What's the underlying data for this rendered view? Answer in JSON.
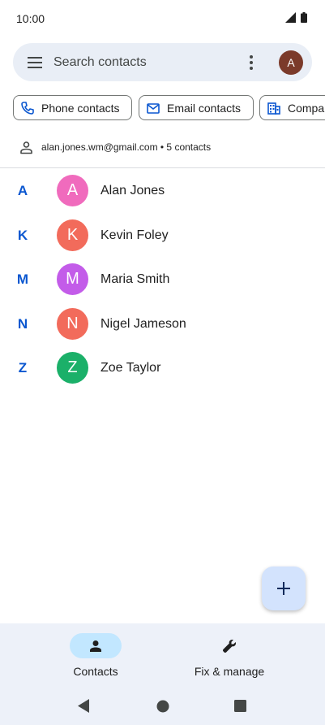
{
  "status_bar": {
    "time": "10:00"
  },
  "search": {
    "placeholder": "Search contacts",
    "account_avatar_letter": "A",
    "account_avatar_color": "#7b3a2a"
  },
  "chips": [
    {
      "label": "Phone contacts",
      "icon": "phone-icon"
    },
    {
      "label": "Email contacts",
      "icon": "email-icon"
    },
    {
      "label": "Compar",
      "icon": "building-icon"
    }
  ],
  "account": {
    "text": "alan.jones.wm@gmail.com • 5 contacts",
    "icon": "person-outline-icon"
  },
  "contacts": [
    {
      "section": "A",
      "initial": "A",
      "name": "Alan Jones",
      "color": "#f06bbd"
    },
    {
      "section": "K",
      "initial": "K",
      "name": "Kevin Foley",
      "color": "#f26b5b"
    },
    {
      "section": "M",
      "initial": "M",
      "name": "Maria Smith",
      "color": "#c35ce9"
    },
    {
      "section": "N",
      "initial": "N",
      "name": "Nigel Jameson",
      "color": "#f26b5b"
    },
    {
      "section": "Z",
      "initial": "Z",
      "name": "Zoe Taylor",
      "color": "#1bb069"
    }
  ],
  "fab": {
    "icon": "plus-icon"
  },
  "bottom_nav": {
    "items": [
      {
        "label": "Contacts",
        "icon": "person-icon",
        "active": true
      },
      {
        "label": "Fix & manage",
        "icon": "wrench-icon",
        "active": false
      }
    ]
  },
  "colors": {
    "accent": "#0b57d0",
    "search_bg": "#e9eef6",
    "nav_bg": "#edf1f9",
    "active_pill": "#c2e7ff",
    "fab_bg": "#d3e3fd"
  }
}
